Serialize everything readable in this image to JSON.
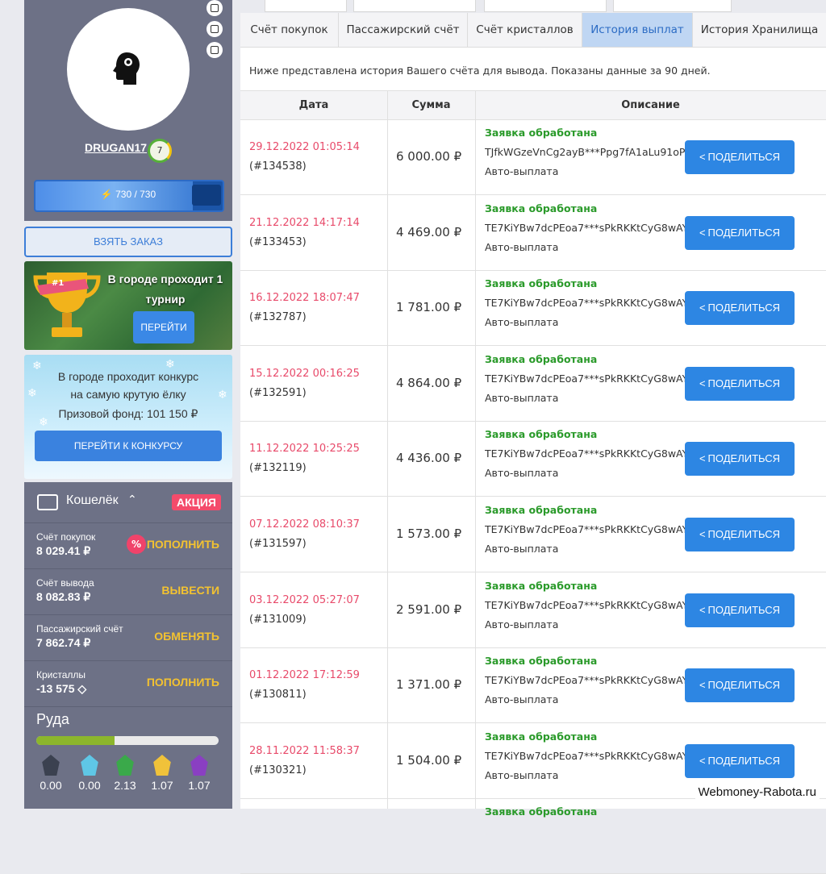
{
  "sidebar": {
    "username": "DRUGAN17",
    "level": "7",
    "energy": {
      "text": "730 / 730",
      "fraction": 1.0
    },
    "take_order_label": "ВЗЯТЬ ЗАКАЗ",
    "tournament": {
      "text": "В городе проходит 1 турнир",
      "badge": "#1",
      "button": "ПЕРЕЙТИ"
    },
    "contest": {
      "text_line1": "В городе проходит конкурс",
      "text_line2": "на самую крутую ёлку",
      "fund": "Призовой фонд: 101 150 ₽",
      "button": "ПЕРЕЙТИ К КОНКУРСУ"
    },
    "wallet": {
      "title": "Кошелёк",
      "promo": "АКЦИЯ",
      "accounts": [
        {
          "name": "Счёт покупок",
          "value": "8 029.41 ₽",
          "action": "ПОПОЛНИТЬ",
          "badge": "%"
        },
        {
          "name": "Счёт вывода",
          "value": "8 082.83 ₽",
          "action": "ВЫВЕСТИ"
        },
        {
          "name": "Пассажирский счёт",
          "value": "7 862.74 ₽",
          "action": "ОБМЕНЯТЬ"
        },
        {
          "name": "Кристаллы",
          "value": "-13 575 ◇",
          "action": "ПОПОЛНИТЬ"
        }
      ],
      "ore_title": "Руда",
      "ore_progress": 0.43,
      "ores": [
        {
          "value": "0.00",
          "color": "#3b4150"
        },
        {
          "value": "0.00",
          "color": "#5fc7e6"
        },
        {
          "value": "2.13",
          "color": "#3aa94a"
        },
        {
          "value": "1.07",
          "color": "#f0c23a"
        },
        {
          "value": "1.07",
          "color": "#8a3fc2"
        }
      ]
    }
  },
  "tabs": [
    {
      "label": "Счёт покупок",
      "active": false
    },
    {
      "label": "Пассажирский счёт",
      "active": false
    },
    {
      "label": "Счёт кристаллов",
      "active": false
    },
    {
      "label": "История выплат",
      "active": true
    },
    {
      "label": "История Хранилища",
      "active": false
    }
  ],
  "info_text": "Ниже представлена история Вашего счёта для вывода. Показаны данные за 90 дней.",
  "table": {
    "headers": [
      "Дата",
      "Сумма",
      "Описание"
    ],
    "share_label": "ПОДЕЛИТЬСЯ",
    "rows": [
      {
        "date": "29.12.2022 01:05:14",
        "id": "(#134538)",
        "amount": "6 000.00 ₽",
        "status": "Заявка обработана",
        "hash": "TJfkWGzeVnCg2ayB***Ppg7fA1aLu91oP6",
        "method": "Авто-выплата"
      },
      {
        "date": "21.12.2022 14:17:14",
        "id": "(#133453)",
        "amount": "4 469.00 ₽",
        "status": "Заявка обработана",
        "hash": "TE7KiYBw7dcPEoa7***sPkRKKtCyG8wAY",
        "method": "Авто-выплата"
      },
      {
        "date": "16.12.2022 18:07:47",
        "id": "(#132787)",
        "amount": "1 781.00 ₽",
        "status": "Заявка обработана",
        "hash": "TE7KiYBw7dcPEoa7***sPkRKKtCyG8wAY",
        "method": "Авто-выплата"
      },
      {
        "date": "15.12.2022 00:16:25",
        "id": "(#132591)",
        "amount": "4 864.00 ₽",
        "status": "Заявка обработана",
        "hash": "TE7KiYBw7dcPEoa7***sPkRKKtCyG8wAY",
        "method": "Авто-выплата"
      },
      {
        "date": "11.12.2022 10:25:25",
        "id": "(#132119)",
        "amount": "4 436.00 ₽",
        "status": "Заявка обработана",
        "hash": "TE7KiYBw7dcPEoa7***sPkRKKtCyG8wAY",
        "method": "Авто-выплата"
      },
      {
        "date": "07.12.2022 08:10:37",
        "id": "(#131597)",
        "amount": "1 573.00 ₽",
        "status": "Заявка обработана",
        "hash": "TE7KiYBw7dcPEoa7***sPkRKKtCyG8wAY",
        "method": "Авто-выплата"
      },
      {
        "date": "03.12.2022 05:27:07",
        "id": "(#131009)",
        "amount": "2 591.00 ₽",
        "status": "Заявка обработана",
        "hash": "TE7KiYBw7dcPEoa7***sPkRKKtCyG8wAY",
        "method": "Авто-выплата"
      },
      {
        "date": "01.12.2022 17:12:59",
        "id": "(#130811)",
        "amount": "1 371.00 ₽",
        "status": "Заявка обработана",
        "hash": "TE7KiYBw7dcPEoa7***sPkRKKtCyG8wAY",
        "method": "Авто-выплата"
      },
      {
        "date": "28.11.2022 11:58:37",
        "id": "(#130321)",
        "amount": "1 504.00 ₽",
        "status": "Заявка обработана",
        "hash": "TE7KiYBw7dcPEoa7***sPkRKKtCyG8wAY",
        "method": "Авто-выплата"
      },
      {
        "date": "",
        "id": "",
        "amount": "",
        "status": "Заявка обработана",
        "hash": "",
        "method": ""
      }
    ]
  },
  "watermark": "Webmoney-Rabota.ru",
  "colors": {
    "accent": "#2d86e3",
    "date": "#e84a6a",
    "status": "#2a9a2a",
    "sidebar": "#6d7186",
    "action": "#f3c230"
  }
}
